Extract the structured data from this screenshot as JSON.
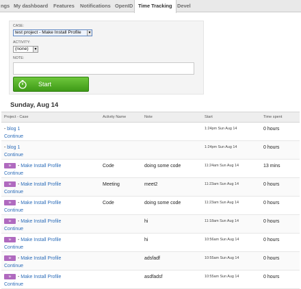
{
  "tabs": [
    {
      "label": "ngs"
    },
    {
      "label": "My dashboard"
    },
    {
      "label": "Features"
    },
    {
      "label": "Notifications"
    },
    {
      "label": "OpenID"
    },
    {
      "label": "Time Tracking"
    },
    {
      "label": "Devel"
    }
  ],
  "form": {
    "case_label": "CASE:",
    "case_value": "test project - Make Install Profile",
    "activity_label": "ACTIVITY:",
    "activity_value": "(none)",
    "note_label": "NOTE:",
    "note_value": "",
    "start_label": "Start"
  },
  "day": {
    "heading": "Sunday, Aug 14"
  },
  "table": {
    "headers": [
      "Project - Case",
      "Activity Name",
      "Note",
      "Start",
      "Time spent"
    ],
    "rows": [
      {
        "tag": "",
        "case": "blog 1",
        "continue": "Continue",
        "activity": "",
        "note": "",
        "start": "1:24pm Sun Aug 14",
        "spent": "0 hours"
      },
      {
        "tag": "",
        "case": "blog 1",
        "continue": "Continue",
        "activity": "",
        "note": "",
        "start": "1:24pm Sun Aug 14",
        "spent": "0 hours"
      },
      {
        "tag": "te",
        "case": "Make Install Profile",
        "continue": "Continue",
        "activity": "Code",
        "note": "doing some code",
        "start": "11:24am Sun Aug 14",
        "spent": "13 mins"
      },
      {
        "tag": "te",
        "case": "Make Install Profile",
        "continue": "Continue",
        "activity": "Meeting",
        "note": "meet2",
        "start": "11:23am Sun Aug 14",
        "spent": "0 hours"
      },
      {
        "tag": "te",
        "case": "Make Install Profile",
        "continue": "Continue",
        "activity": "Code",
        "note": "doing some code",
        "start": "11:23am Sun Aug 14",
        "spent": "0 hours"
      },
      {
        "tag": "te",
        "case": "Make Install Profile",
        "continue": "Continue",
        "activity": "",
        "note": "hi",
        "start": "11:18am Sun Aug 14",
        "spent": "0 hours"
      },
      {
        "tag": "te",
        "case": "Make Install Profile",
        "continue": "Continue",
        "activity": "",
        "note": "hi",
        "start": "10:56am Sun Aug 14",
        "spent": "0 hours"
      },
      {
        "tag": "te",
        "case": "Make Install Profile",
        "continue": "Continue",
        "activity": "",
        "note": "adsfadf",
        "start": "10:55am Sun Aug 14",
        "spent": "0 hours"
      },
      {
        "tag": "te",
        "case": "Make Install Profile",
        "continue": "Continue",
        "activity": "",
        "note": "asdfadsf",
        "start": "10:55am Sun Aug 14",
        "spent": "0 hours"
      }
    ]
  }
}
